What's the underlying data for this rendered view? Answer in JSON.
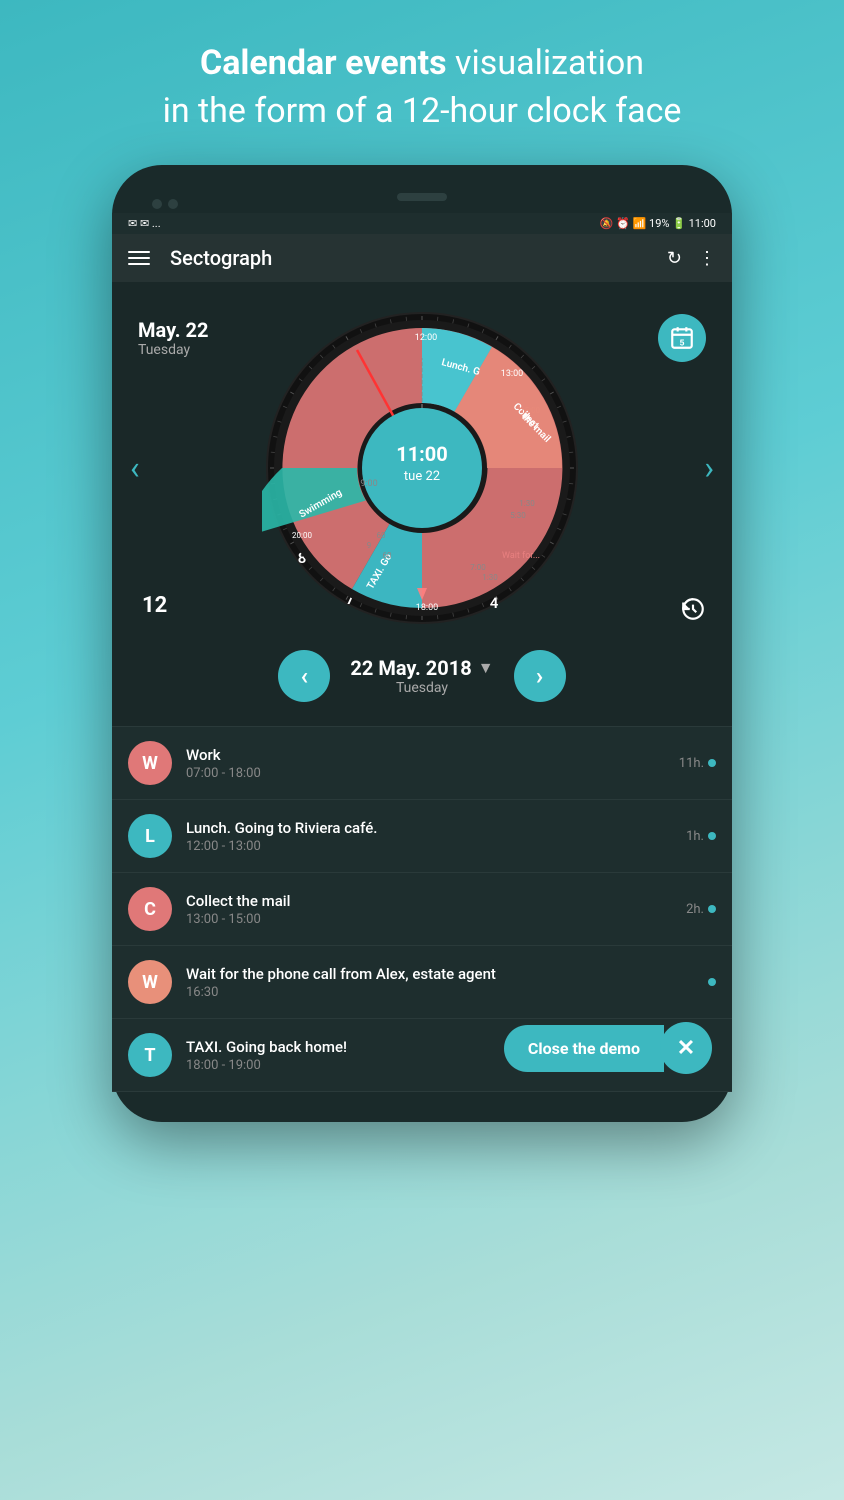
{
  "header": {
    "line1_bold": "Calendar events",
    "line1_rest": " visualization",
    "line2": "in the form of a 12-hour clock face"
  },
  "status_bar": {
    "left_icons": "✉ ✉ ...",
    "right_text": "🔕 ⏰  📶 19% 🔋 11:00"
  },
  "app_bar": {
    "title": "Sectograph"
  },
  "clock": {
    "center_time": "11:00",
    "center_date": "tue 22"
  },
  "date_nav": {
    "date_text": "22 May. 2018",
    "day_text": "Tuesday"
  },
  "events": [
    {
      "id": "work",
      "letter": "W",
      "color": "#e07060",
      "title": "Work",
      "time": "07:00 - 18:00",
      "duration": "11h.",
      "dot_color": "#3db8c0"
    },
    {
      "id": "lunch",
      "letter": "L",
      "color": "#3db8c0",
      "title": "Lunch. Going to Riviera café.",
      "time": "12:00 - 13:00",
      "duration": "1h.",
      "dot_color": "#3db8c0"
    },
    {
      "id": "collect",
      "letter": "C",
      "color": "#e07060",
      "title": "Collect the mail",
      "time": "13:00 - 15:00",
      "duration": "2h.",
      "dot_color": "#3db8c0"
    },
    {
      "id": "wait",
      "letter": "W",
      "color": "#e07060",
      "title": "Wait for the phone call from Alex, estate agent",
      "time": "16:30",
      "duration": "",
      "dot_color": "#3db8c0"
    },
    {
      "id": "taxi",
      "letter": "T",
      "color": "#3db8c0",
      "title": "TAXI. Going back home!",
      "time": "18:00 - 19:00",
      "duration": "",
      "dot_color": ""
    }
  ],
  "close_demo": {
    "label": "Close the demo"
  },
  "day_12": "12",
  "date_display": {
    "date": "May. 22",
    "day": "Tuesday"
  }
}
